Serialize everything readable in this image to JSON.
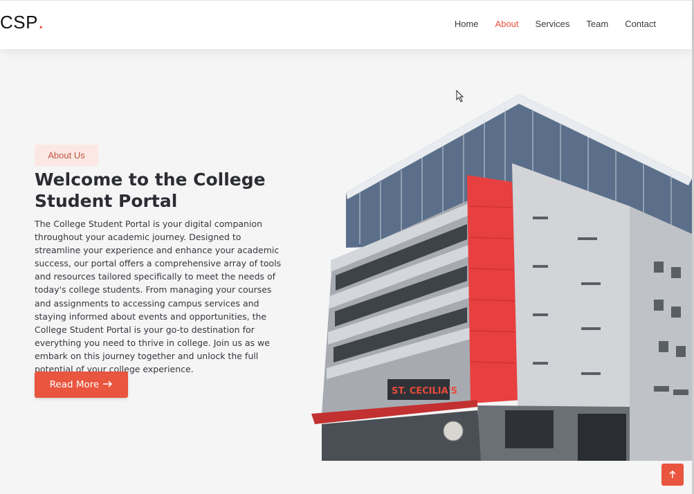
{
  "header": {
    "logo_text": "CSP",
    "logo_dot": ".",
    "nav": [
      {
        "label": "Home",
        "active": false
      },
      {
        "label": "About",
        "active": true
      },
      {
        "label": "Services",
        "active": false
      },
      {
        "label": "Team",
        "active": false
      },
      {
        "label": "Contact",
        "active": false
      }
    ]
  },
  "hero": {
    "badge": "About Us",
    "title": "Welcome to the College Student Portal",
    "description": "The College Student Portal is your digital companion throughout your academic journey. Designed to streamline your experience and enhance your academic success, our portal offers a comprehensive array of tools and resources tailored specifically to meet the needs of today's college students. From managing your courses and assignments to accessing campus services and staying informed about events and opportunities, the College Student Portal is your go-to destination for everything you need to thrive in college. Join us as we embark on this journey together and unlock the full potential of your college experience.",
    "button_label": "Read More",
    "button_icon": "arrow-right-icon",
    "image_sign": "ST. CECILIA'S"
  },
  "scroll_top_icon": "arrow-up-icon",
  "colors": {
    "accent": "#e9553e",
    "badge_bg": "#fbe8e4",
    "page_bg": "#f5f5f6",
    "heading": "#2b2d33"
  }
}
